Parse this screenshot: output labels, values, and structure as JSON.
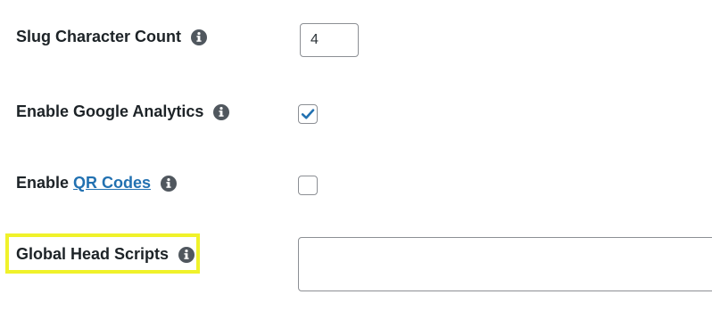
{
  "settings": {
    "slug_count": {
      "label": "Slug Character Count",
      "value": "4"
    },
    "google_analytics": {
      "label": "Enable Google Analytics",
      "checked": true
    },
    "qr_codes": {
      "label_prefix": "Enable",
      "link_text": "QR Codes",
      "checked": false
    },
    "head_scripts": {
      "label": "Global Head Scripts",
      "value": ""
    }
  },
  "icons": {
    "info": "info-circle-icon",
    "check": "checkmark-icon"
  },
  "colors": {
    "text": "#1d2327",
    "link": "#2271b1",
    "icon": "#50575e",
    "check": "#2271b1",
    "highlight": "#f0f22a",
    "border": "#8c8f94"
  }
}
